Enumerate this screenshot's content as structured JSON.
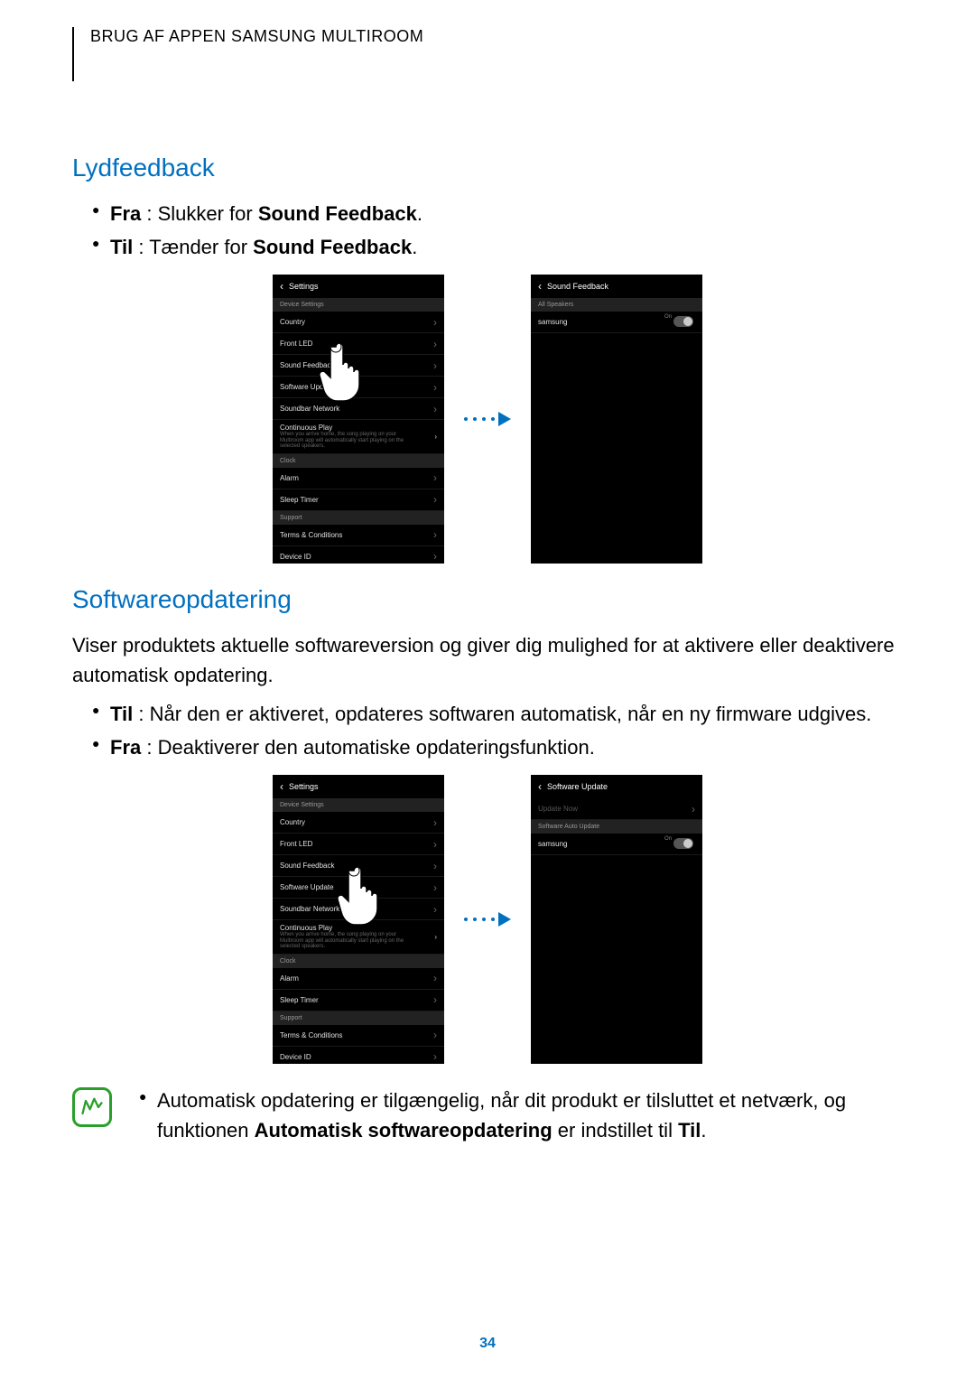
{
  "header": "BRUG AF APPEN SAMSUNG MULTIROOM",
  "section1": {
    "title": "Lydfeedback",
    "bullets": [
      {
        "bold": "Fra",
        "rest": " : Slukker for ",
        "bold2": "Sound Feedback",
        "tail": "."
      },
      {
        "bold": "Til",
        "rest": " : Tænder for ",
        "bold2": "Sound Feedback",
        "tail": "."
      }
    ]
  },
  "section2": {
    "title": "Softwareopdatering",
    "intro": "Viser produktets aktuelle softwareversion og giver dig mulighed for at aktivere eller deaktivere automatisk opdatering.",
    "bullets": [
      {
        "bold": "Til",
        "rest": " : Når den er aktiveret, opdateres softwaren automatisk, når en ny firmware udgives."
      },
      {
        "bold": "Fra",
        "rest": " : Deaktiverer den automatiske opdateringsfunktion."
      }
    ]
  },
  "note": {
    "text_pre": "Automatisk opdatering er tilgængelig, når dit produkt er tilsluttet et netværk, og funktionen ",
    "bold": "Automatisk softwareopdatering",
    "text_mid": " er indstillet til ",
    "bold2": "Til",
    "tail": "."
  },
  "settings_screen": {
    "title": "Settings",
    "device_settings": "Device Settings",
    "items": [
      "Country",
      "Front LED",
      "Sound Feedback",
      "Software Update",
      "Soundbar Network"
    ],
    "continuous_play": "Continuous Play",
    "continuous_sub": "When you arrive home, the song playing on your Multiroom app will automatically start playing on the selected speakers.",
    "clock": "Clock",
    "items2": [
      "Alarm",
      "Sleep Timer"
    ],
    "support": "Support",
    "items3": [
      "Terms & Conditions",
      "Device ID"
    ]
  },
  "sound_feedback_screen": {
    "title": "Sound Feedback",
    "all_speakers": "All Speakers",
    "speaker": "samsung",
    "toggle": "On"
  },
  "software_update_screen": {
    "title": "Software Update",
    "update_now": "Update Now",
    "auto_update": "Software Auto Update",
    "speaker": "samsung",
    "toggle": "On"
  },
  "page_number": "34"
}
